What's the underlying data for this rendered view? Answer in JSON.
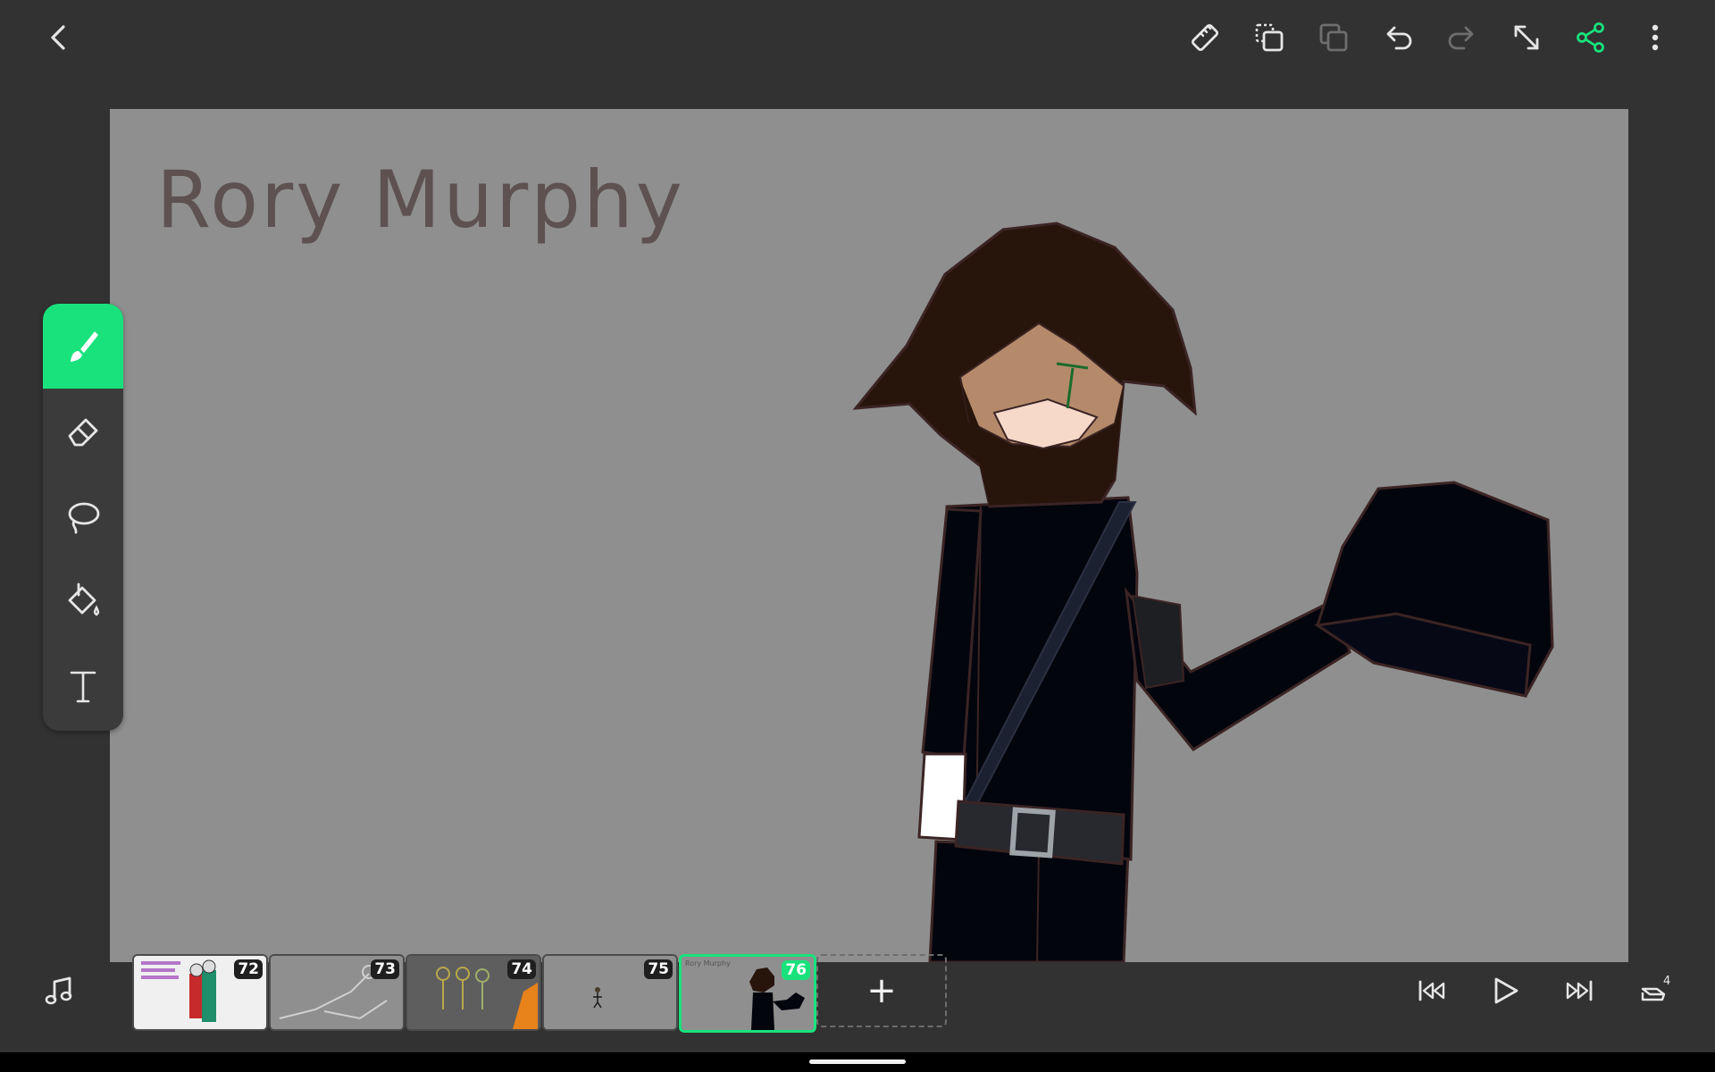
{
  "app": {
    "canvas_title": "Rory Murphy",
    "accent_color": "#19e27c",
    "canvas_color": "#8f8f8f"
  },
  "topbar": {
    "icons": [
      "back-icon",
      "ruler-icon",
      "duplicate-frame-icon",
      "copy-frame-icon",
      "undo-icon",
      "redo-icon",
      "resize-icon",
      "share-icon",
      "more-icon"
    ]
  },
  "tools": [
    "brush-icon",
    "eraser-icon",
    "lasso-icon",
    "fill-bucket-icon",
    "text-icon"
  ],
  "timeline": {
    "frames": [
      {
        "number": "72"
      },
      {
        "number": "73"
      },
      {
        "number": "74"
      },
      {
        "number": "75"
      },
      {
        "number": "76",
        "label": "Rory Murphy"
      }
    ],
    "add_label": "+",
    "layers_count": "4"
  }
}
